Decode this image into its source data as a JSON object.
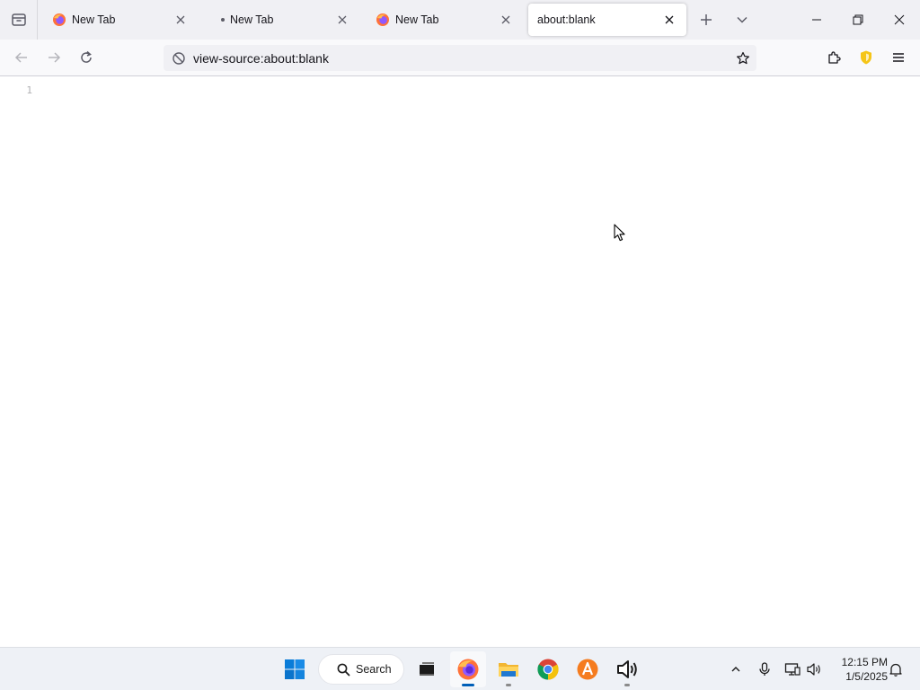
{
  "tabs": [
    {
      "title": "New Tab",
      "favicon": "firefox-icon"
    },
    {
      "title": "New Tab",
      "favicon": "loading-dot"
    },
    {
      "title": "New Tab",
      "favicon": "firefox-icon"
    },
    {
      "title": "about:blank",
      "active": true
    }
  ],
  "toolbar": {
    "url": "view-source:about:blank"
  },
  "content": {
    "line_numbers": [
      "1"
    ]
  },
  "taskbar": {
    "search_label": "Search",
    "apps": [
      "start-icon",
      "search",
      "task-view-icon",
      "firefox-icon",
      "file-explorer-icon",
      "chrome-icon",
      "app-icon",
      "speaker-app-icon"
    ]
  },
  "clock": {
    "time": "12:15 PM",
    "date": "1/5/2025"
  },
  "colors": {
    "accent": "#005fb8",
    "tab_strip": "#f0f0f4",
    "shield": "#f5c518"
  }
}
